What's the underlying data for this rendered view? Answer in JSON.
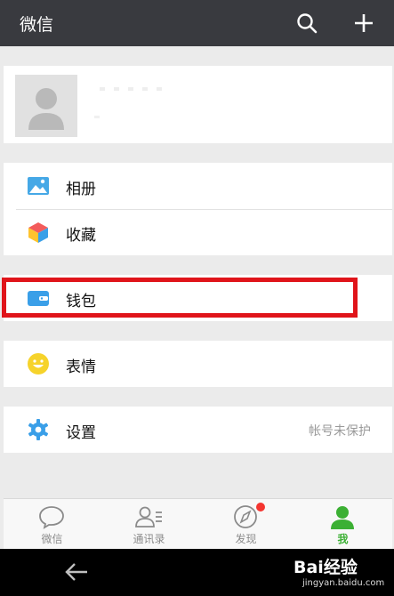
{
  "header": {
    "title": "微信",
    "search_icon": "search-icon",
    "add_icon": "plus-icon"
  },
  "profile": {
    "avatar_icon": "default-avatar-icon"
  },
  "menu": {
    "album": {
      "label": "相册",
      "icon": "album-icon"
    },
    "favorites": {
      "label": "收藏",
      "icon": "favorites-cube-icon"
    },
    "wallet": {
      "label": "钱包",
      "icon": "wallet-icon"
    },
    "stickers": {
      "label": "表情",
      "icon": "smiley-icon"
    },
    "settings": {
      "label": "设置",
      "hint": "帐号未保护",
      "icon": "gear-icon"
    }
  },
  "tabs": [
    {
      "label": "微信",
      "icon": "chat-bubble-icon",
      "active": false
    },
    {
      "label": "通讯录",
      "icon": "contacts-icon",
      "active": false
    },
    {
      "label": "发现",
      "icon": "compass-icon",
      "active": false,
      "badge_dot": true
    },
    {
      "label": "我",
      "icon": "person-icon",
      "active": true
    }
  ],
  "colors": {
    "topbar": "#393a3f",
    "active_tab": "#3cb034",
    "highlight": "#e0141a",
    "badge": "#f43530"
  },
  "watermark": {
    "logo": "Bai经验",
    "url": "jingyan.baidu.com"
  }
}
